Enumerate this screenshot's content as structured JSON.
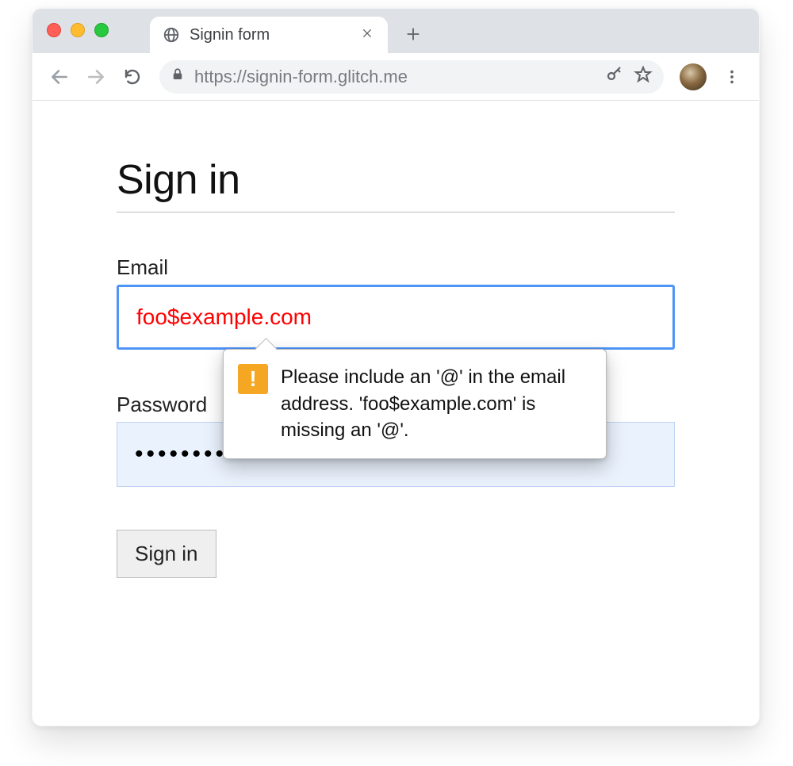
{
  "browser": {
    "tab_title": "Signin form",
    "url": "https://signin-form.glitch.me"
  },
  "page": {
    "title": "Sign in",
    "email_label": "Email",
    "email_value": "foo$example.com",
    "password_label": "Password",
    "password_value": "••••••••••",
    "signin_button": "Sign in"
  },
  "validation": {
    "message": "Please include an '@' in the email address. 'foo$example.com' is missing an '@'."
  }
}
